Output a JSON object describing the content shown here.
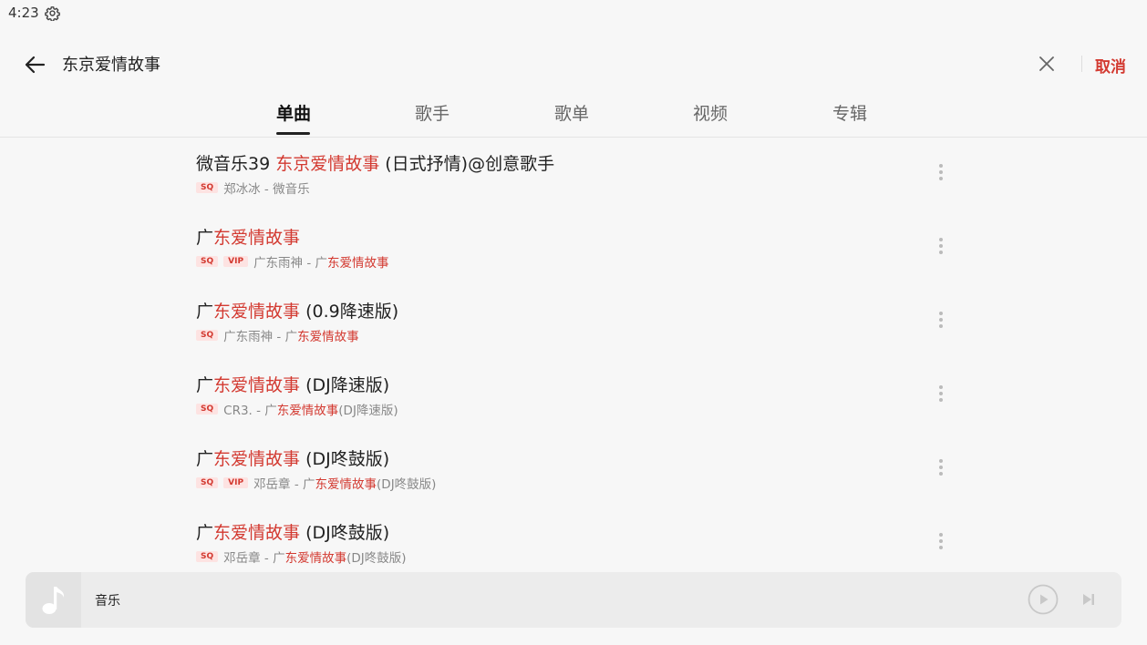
{
  "status_bar": {
    "time": "4:23"
  },
  "search": {
    "query": "东京爱情故事",
    "cancel_label": "取消"
  },
  "tabs": [
    {
      "label": "单曲",
      "active": true
    },
    {
      "label": "歌手",
      "active": false
    },
    {
      "label": "歌单",
      "active": false
    },
    {
      "label": "视频",
      "active": false
    },
    {
      "label": "专辑",
      "active": false
    }
  ],
  "songs": [
    {
      "title_parts": [
        {
          "text": "微音乐39 ",
          "hl": false
        },
        {
          "text": "东京爱情故事",
          "hl": true
        },
        {
          "text": " (日式抒情)@创意歌手",
          "hl": false
        }
      ],
      "badges": [
        "SQ"
      ],
      "meta_parts": [
        {
          "text": "郑冰冰 - 微音乐",
          "hl": false
        }
      ]
    },
    {
      "title_parts": [
        {
          "text": "广",
          "hl": false
        },
        {
          "text": "东爱情故事",
          "hl": true
        }
      ],
      "badges": [
        "SQ",
        "VIP"
      ],
      "meta_parts": [
        {
          "text": "广东雨神 - 广",
          "hl": false
        },
        {
          "text": "东爱情故事",
          "hl": true
        }
      ]
    },
    {
      "title_parts": [
        {
          "text": "广",
          "hl": false
        },
        {
          "text": "东爱情故事",
          "hl": true
        },
        {
          "text": " (0.9降速版)",
          "hl": false
        }
      ],
      "badges": [
        "SQ"
      ],
      "meta_parts": [
        {
          "text": "广东雨神 - 广",
          "hl": false
        },
        {
          "text": "东爱情故事",
          "hl": true
        }
      ]
    },
    {
      "title_parts": [
        {
          "text": "广",
          "hl": false
        },
        {
          "text": "东爱情故事",
          "hl": true
        },
        {
          "text": " (DJ降速版)",
          "hl": false
        }
      ],
      "badges": [
        "SQ"
      ],
      "meta_parts": [
        {
          "text": "CR3. - 广",
          "hl": false
        },
        {
          "text": "东爱情故事",
          "hl": true
        },
        {
          "text": " (DJ降速版)",
          "hl": false
        }
      ]
    },
    {
      "title_parts": [
        {
          "text": "广",
          "hl": false
        },
        {
          "text": "东爱情故事",
          "hl": true
        },
        {
          "text": " (DJ咚鼓版)",
          "hl": false
        }
      ],
      "badges": [
        "SQ",
        "VIP"
      ],
      "meta_parts": [
        {
          "text": "邓岳章 - 广",
          "hl": false
        },
        {
          "text": "东爱情故事",
          "hl": true
        },
        {
          "text": " (DJ咚鼓版)",
          "hl": false
        }
      ]
    },
    {
      "title_parts": [
        {
          "text": "广",
          "hl": false
        },
        {
          "text": "东爱情故事",
          "hl": true
        },
        {
          "text": " (DJ咚鼓版)",
          "hl": false
        }
      ],
      "badges": [
        "SQ"
      ],
      "meta_parts": [
        {
          "text": "邓岳章 - 广",
          "hl": false
        },
        {
          "text": "东爱情故事",
          "hl": true
        },
        {
          "text": " (DJ咚鼓版)",
          "hl": false
        }
      ]
    }
  ],
  "player": {
    "title": "音乐"
  },
  "icons": {
    "status_gear": "gear-icon",
    "back": "arrow-left-icon",
    "clear": "close-icon",
    "more": "more-vertical-icon",
    "cover": "music-note-icon",
    "play": "play-icon",
    "next": "skip-next-icon"
  },
  "colors": {
    "accent": "#d33a31",
    "badge_bg": "#fde3e2",
    "background": "#f7f7f7"
  }
}
